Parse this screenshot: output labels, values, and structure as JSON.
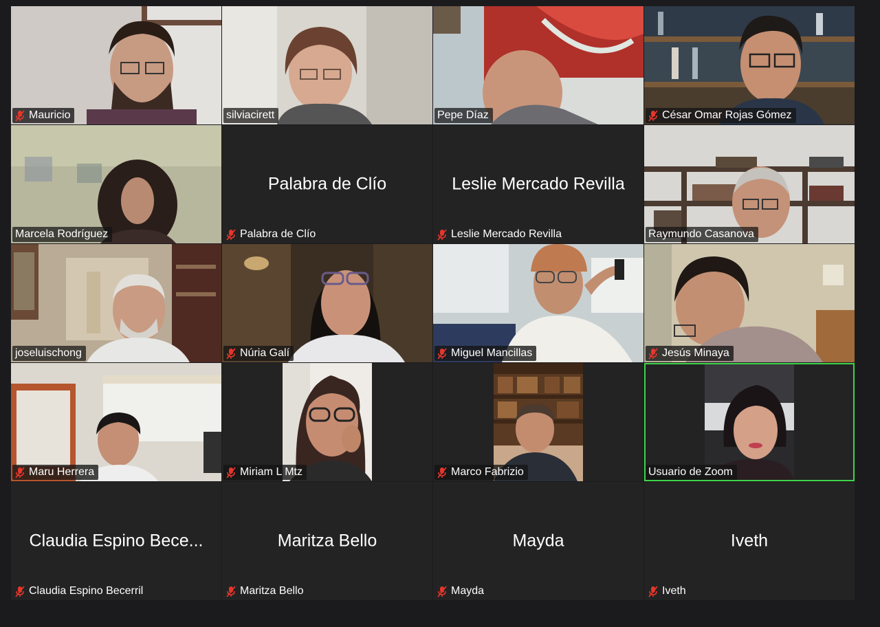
{
  "participants": [
    {
      "name": "Mauricio",
      "muted": true,
      "video": true
    },
    {
      "name": "silviacirett",
      "muted": false,
      "video": true
    },
    {
      "name": "Pepe Díaz",
      "muted": false,
      "video": true
    },
    {
      "name": "César Omar Rojas Gómez",
      "muted": true,
      "video": true
    },
    {
      "name": "Marcela Rodríguez",
      "muted": false,
      "video": true
    },
    {
      "name": "Palabra de Clío",
      "display_name": "Palabra de Clío",
      "muted": true,
      "video": false
    },
    {
      "name": "Leslie Mercado Revilla",
      "display_name": "Leslie Mercado Revilla",
      "muted": true,
      "video": false
    },
    {
      "name": "Raymundo Casanova",
      "muted": false,
      "video": true
    },
    {
      "name": "joseluischong",
      "muted": false,
      "video": true
    },
    {
      "name": "Núria Galí",
      "muted": true,
      "video": true
    },
    {
      "name": "Miguel Mancillas",
      "muted": true,
      "video": true
    },
    {
      "name": "Jesús Minaya",
      "muted": true,
      "video": true
    },
    {
      "name": "Maru Herrera",
      "muted": true,
      "video": true
    },
    {
      "name": "Miriam L Mtz",
      "muted": true,
      "video": true
    },
    {
      "name": "Marco Fabrizio",
      "muted": true,
      "video": true
    },
    {
      "name": "Usuario de Zoom",
      "muted": false,
      "video": true,
      "active_speaker": true
    },
    {
      "name": "Claudia Espino Becerril",
      "display_name": "Claudia Espino Bece...",
      "muted": true,
      "video": false
    },
    {
      "name": "Maritza Bello",
      "display_name": "Maritza Bello",
      "muted": true,
      "video": false
    },
    {
      "name": "Mayda",
      "display_name": "Mayda",
      "muted": true,
      "video": false
    },
    {
      "name": "Iveth",
      "display_name": "Iveth",
      "muted": true,
      "video": false
    }
  ],
  "colors": {
    "background": "#1b1b1e",
    "tile_background": "#232323",
    "active_speaker_border": "#3fd54a",
    "muted_icon": "#e5362c",
    "text": "#ffffff"
  },
  "icons": {
    "muted": "mic-muted-icon"
  }
}
